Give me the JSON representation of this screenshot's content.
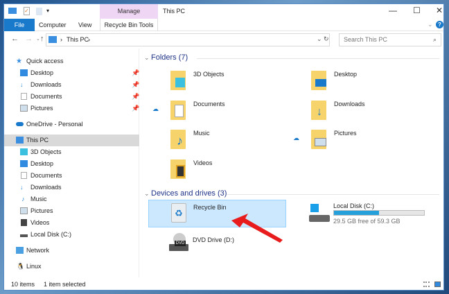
{
  "window": {
    "title": "This PC",
    "minimize": "—",
    "maximize": "☐",
    "close": "✕",
    "help": "?"
  },
  "ribbon": {
    "manage": "Manage",
    "tabs": [
      "File",
      "Computer",
      "View",
      "Recycle Bin Tools"
    ]
  },
  "address": {
    "path": [
      "This PC"
    ],
    "search_placeholder": "Search This PC"
  },
  "nav": {
    "quick_access": "Quick access",
    "quick": [
      "Desktop",
      "Downloads",
      "Documents",
      "Pictures"
    ],
    "onedrive": "OneDrive - Personal",
    "this_pc": "This PC",
    "pc": [
      "3D Objects",
      "Desktop",
      "Documents",
      "Downloads",
      "Music",
      "Pictures",
      "Videos",
      "Local Disk (C:)"
    ],
    "network": "Network",
    "linux": "Linux"
  },
  "content": {
    "folders_header": "Folders (7)",
    "folders": [
      "3D Objects",
      "Desktop",
      "Documents",
      "Downloads",
      "Music",
      "Pictures",
      "Videos"
    ],
    "devices_header": "Devices and drives (3)",
    "recycle_bin": "Recycle Bin",
    "dvd": "DVD Drive (D:)",
    "local_disk": {
      "name": "Local Disk (C:)",
      "free": "29.5 GB free of 59.3 GB",
      "used_fraction": 0.503
    }
  },
  "status": {
    "items": "10 items",
    "selected": "1 item selected"
  },
  "colors": {
    "accent": "#1979ca",
    "selection": "#cce8ff",
    "bar": "#26a0da",
    "arrow": "#e81c1c"
  }
}
